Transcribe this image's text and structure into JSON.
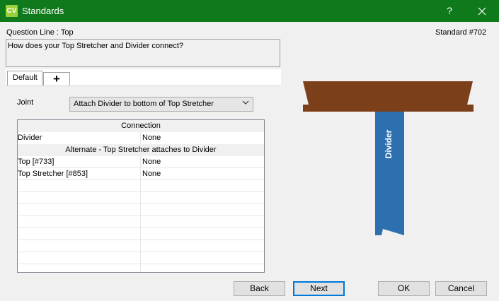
{
  "window": {
    "app_icon_text": "CV",
    "title": "Standards",
    "help_label": "?",
    "close_label": "✕"
  },
  "header": {
    "question_line_label": "Question Line : Top",
    "standard_label": "Standard #702",
    "question_text": "How does your Top Stretcher and Divider connect?"
  },
  "tabs": [
    {
      "label": "Default"
    },
    {
      "label": "+"
    }
  ],
  "joint": {
    "label": "Joint",
    "selected": "Attach Divider to bottom of Top Stretcher"
  },
  "grid": {
    "section1_header": "Connection",
    "section1_rows": [
      {
        "name": "Divider",
        "value": "None"
      }
    ],
    "section2_header": "Alternate - Top Stretcher attaches to Divider",
    "section2_rows": [
      {
        "name": "Top [#733]",
        "value": "None"
      },
      {
        "name": "Top Stretcher [#853]",
        "value": "None"
      }
    ]
  },
  "diagram": {
    "divider_label": "Divider",
    "stretcher_color": "#7b3f1a",
    "divider_color": "#2e6fb0"
  },
  "buttons": {
    "back": "Back",
    "next": "Next",
    "ok": "OK",
    "cancel": "Cancel"
  }
}
